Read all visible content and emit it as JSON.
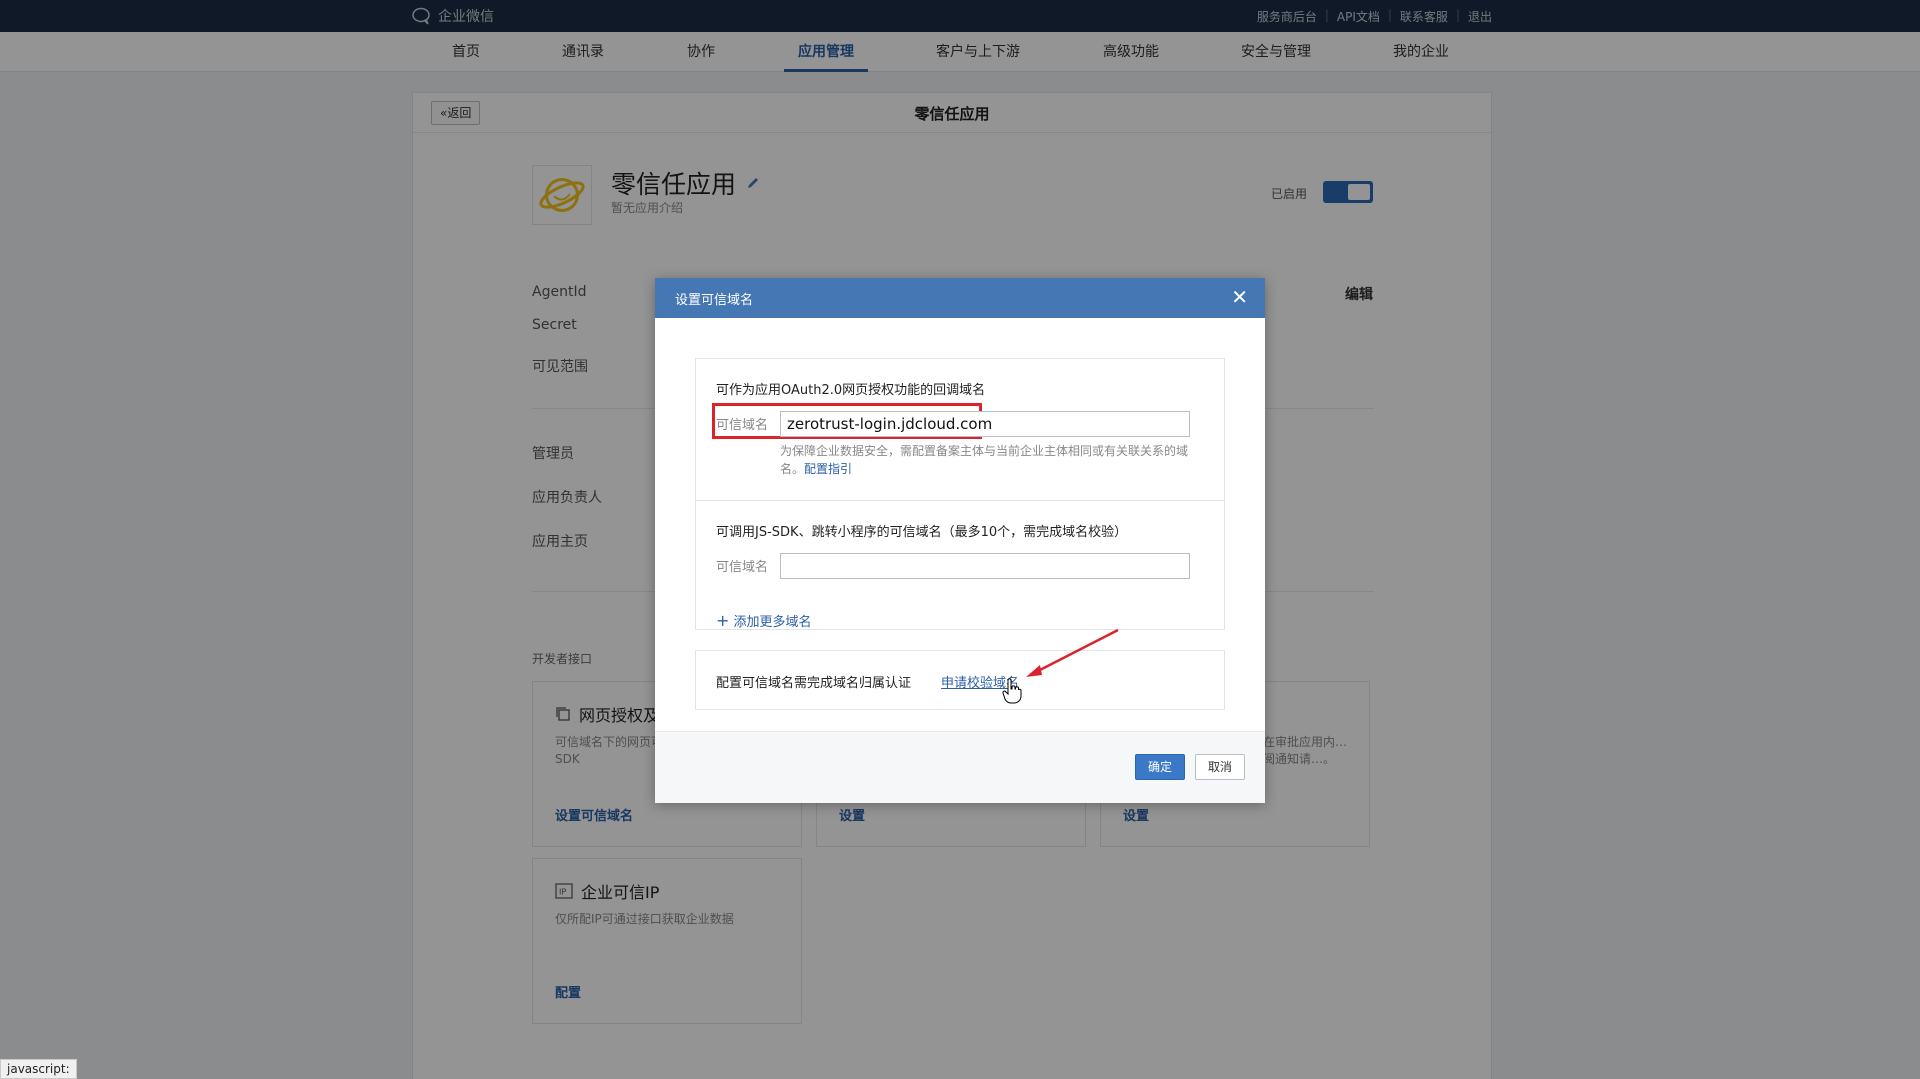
{
  "topbar": {
    "logo_text": "企业微信",
    "links": [
      "服务商后台",
      "API文档",
      "联系客服",
      "退出"
    ]
  },
  "nav": {
    "items": [
      "首页",
      "通讯录",
      "协作",
      "应用管理",
      "客户与上下游",
      "高级功能",
      "安全与管理",
      "我的企业"
    ],
    "active": "应用管理"
  },
  "page": {
    "back_label": "返回",
    "title": "零信任应用"
  },
  "app": {
    "name": "零信任应用",
    "intro": "暂无应用介绍",
    "status_label": "已启用",
    "enabled": true
  },
  "fields": {
    "agentid": "AgentId",
    "secret": "Secret",
    "visible_range": "可见范围",
    "edit": "编辑",
    "admin": "管理员",
    "owner": "应用负责人",
    "homepage": "应用主页"
  },
  "dev": {
    "section_title": "开发者接口",
    "cards": [
      {
        "title": "网页授权及JS-SDK",
        "desc": "可信域名下的网页可以使用网页授权及JS-SDK",
        "action": "设置可信域名"
      },
      {
        "title": "",
        "desc": "",
        "action": "设置"
      },
      {
        "title": "",
        "desc": "…在审批应用内…订阅通知请…。",
        "action": "设置"
      },
      {
        "title": "企业可信IP",
        "desc": "仅所配IP可通过接口获取企业数据",
        "action": "配置"
      }
    ]
  },
  "dialog": {
    "title": "设置可信域名",
    "close": "✕",
    "oauth_title": "可作为应用OAuth2.0网页授权功能的回调域名",
    "domain_label": "可信域名",
    "oauth_domain_value": "zerotrust-login.jdcloud.com",
    "hint": "为保障企业数据安全，需配置备案主体与当前企业主体相同或有关联关系的域名。",
    "hint_link": "配置指引",
    "jssdk_title": "可调用JS-SDK、跳转小程序的可信域名（最多10个，需完成域名校验）",
    "jssdk_domain_value": "",
    "add_more": "添加更多域名",
    "add_more_icon": "+",
    "verify_text": "配置可信域名需完成域名归属认证",
    "verify_link": "申请校验域名",
    "ok": "确定",
    "cancel": "取消"
  },
  "status_bar": "javascript:",
  "colors": {
    "topbar": "#1c2b44",
    "accent": "#2a5fa8",
    "dialog_header": "#4677b5",
    "highlight": "#d9242c"
  }
}
